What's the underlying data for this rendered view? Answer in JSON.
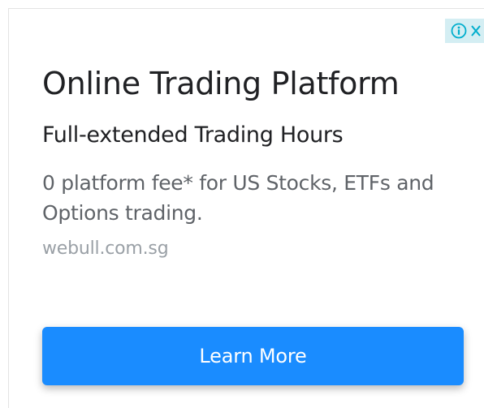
{
  "ad": {
    "headline": "Online Trading Platform",
    "subheadline": "Full-extended Trading Hours",
    "description": "0 platform fee* for US Stocks, ETFs and Options trading.",
    "display_url": "webull.com.sg",
    "cta_label": "Learn More"
  },
  "adchoices": {
    "info_icon": "info-icon",
    "close_icon": "close-icon"
  },
  "colors": {
    "cta_background": "#1a8cff",
    "cta_text": "#ffffff",
    "headline_text": "#202124",
    "description_text": "#5f6368",
    "url_text": "#9aa0a6",
    "adchoices_background": "#d4eef3",
    "adchoices_icon": "#00aecd"
  }
}
